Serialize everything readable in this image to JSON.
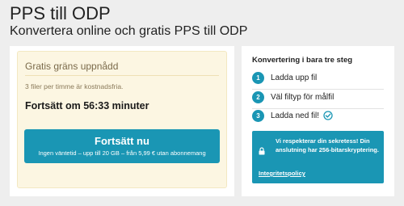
{
  "header": {
    "title": "PPS till ODP",
    "subtitle": "Konvertera online och gratis PPS till ODP"
  },
  "limit": {
    "title": "Gratis gräns uppnådd",
    "rate_text": "3 filer per timme är kostnadsfria.",
    "wait_text": "Fortsätt om 56:33 minuter",
    "button_label": "Fortsätt nu",
    "button_desc": "Ingen väntetid – upp till 20 GB – från 5,99 € utan abonnemang"
  },
  "steps": {
    "title": "Konvertering i bara tre steg",
    "items": [
      {
        "number": "1",
        "label": "Ladda upp fil"
      },
      {
        "number": "2",
        "label": "Väl filtyp för målfil"
      },
      {
        "number": "3",
        "label": "Ladda ned fil!"
      }
    ]
  },
  "privacy": {
    "text": "Vi respekterar din sekretess! Din anslutning har 256-bitarskryptering.",
    "link_label": "Integritetspolicy"
  },
  "colors": {
    "accent": "#1a96b4",
    "notice_bg": "#fcf6e2",
    "page_bg": "#eeeeee"
  }
}
